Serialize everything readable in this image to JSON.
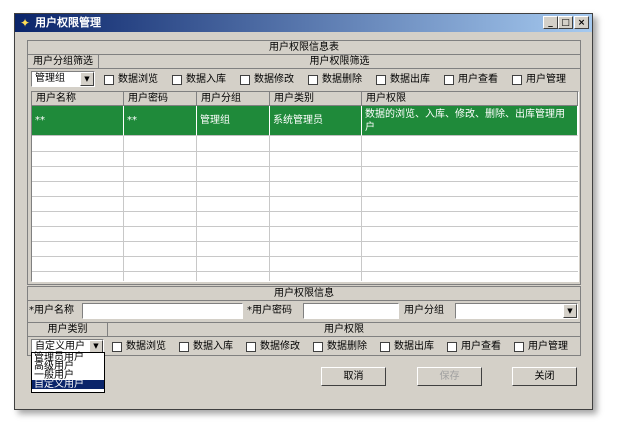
{
  "window": {
    "title": "用户权限管理",
    "minimize": "_",
    "maximize": "□",
    "close": "×"
  },
  "top_panel": {
    "title": "用户权限信息表",
    "group_filter_label": "用户分组筛选",
    "perm_filter_label": "用户权限筛选",
    "group_value": "管理组",
    "permissions": [
      "数据浏览",
      "数据入库",
      "数据修改",
      "数据删除",
      "数据出库",
      "用户查看",
      "用户管理"
    ]
  },
  "grid": {
    "columns": [
      "用户名称",
      "用户密码",
      "用户分组",
      "用户类别",
      "用户权限"
    ],
    "rows": [
      {
        "name": "**",
        "password": "**",
        "group": "管理组",
        "type": "系统管理员",
        "perms": "数据的浏览、入库、修改、删除、出库管理用户"
      }
    ]
  },
  "bottom_panel": {
    "title": "用户权限信息",
    "name_label": "*用户名称",
    "name_value": "",
    "password_label": "*用户密码",
    "password_value": "",
    "group_label": "用户分组",
    "group_value": "",
    "type_label": "用户类别",
    "perm_label": "用户权限",
    "type_value": "自定义用户",
    "type_options": [
      "管理员用户",
      "高级用户",
      "一般用户",
      "自定义用户"
    ],
    "permissions": [
      "数据浏览",
      "数据入库",
      "数据修改",
      "数据删除",
      "数据出库",
      "用户查看",
      "用户管理"
    ]
  },
  "buttons": {
    "cancel": "取消",
    "save": "保存",
    "close": "关闭"
  }
}
